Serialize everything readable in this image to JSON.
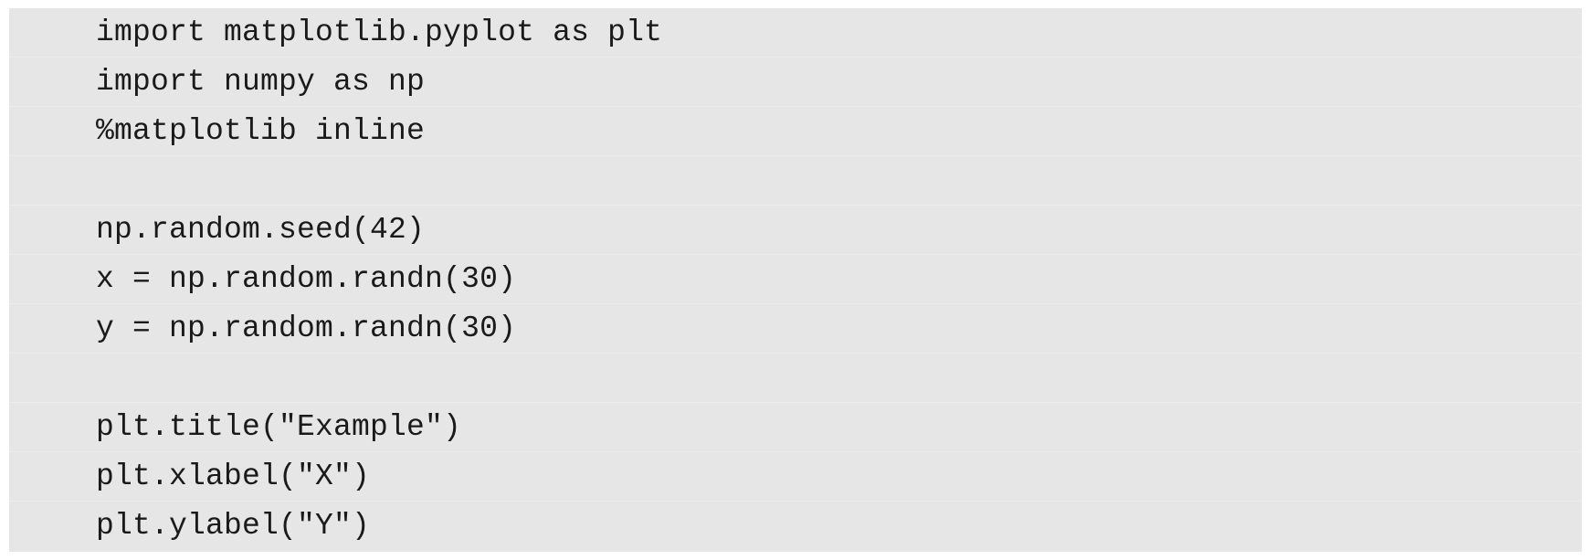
{
  "code": {
    "lines": [
      "import matplotlib.pyplot as plt",
      "import numpy as np",
      "%matplotlib inline",
      "",
      "np.random.seed(42)",
      "x = np.random.randn(30)",
      "y = np.random.randn(30)",
      "",
      "plt.title(\"Example\")",
      "plt.xlabel(\"X\")",
      "plt.ylabel(\"Y\")"
    ]
  }
}
